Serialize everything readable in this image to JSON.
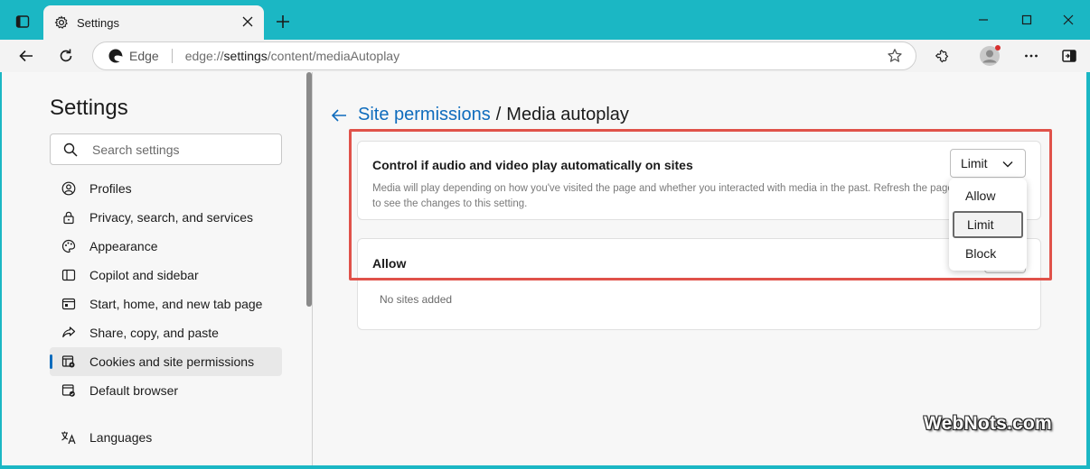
{
  "titlebar": {
    "tab_title": "Settings",
    "new_tab_icon": "plus-icon",
    "window_controls": [
      "minimize",
      "maximize",
      "close"
    ]
  },
  "navbar": {
    "site_label": "Edge",
    "url_prefix": "edge://",
    "url_host": "settings",
    "url_path": "/content/mediaAutoplay"
  },
  "sidebar": {
    "title": "Settings",
    "search_placeholder": "Search settings",
    "items": [
      {
        "label": "Profiles",
        "icon": "profile-icon"
      },
      {
        "label": "Privacy, search, and services",
        "icon": "lock-icon"
      },
      {
        "label": "Appearance",
        "icon": "palette-icon"
      },
      {
        "label": "Copilot and sidebar",
        "icon": "sidebar-icon"
      },
      {
        "label": "Start, home, and new tab page",
        "icon": "home-icon"
      },
      {
        "label": "Share, copy, and paste",
        "icon": "share-icon"
      },
      {
        "label": "Cookies and site permissions",
        "icon": "cookies-icon",
        "active": true
      },
      {
        "label": "Default browser",
        "icon": "browser-icon"
      },
      {
        "label": "Languages",
        "icon": "languages-icon"
      }
    ]
  },
  "main": {
    "breadcrumb_link": "Site permissions",
    "breadcrumb_sep": "/",
    "breadcrumb_current": "Media autoplay",
    "autoplay_card": {
      "heading": "Control if audio and video play automatically on sites",
      "description": "Media will play depending on how you've visited the page and whether you interacted with media in the past. Refresh the page to see the changes to this setting.",
      "selected_value": "Limit"
    },
    "allow_card": {
      "heading": "Allow",
      "empty_text": "No sites added"
    },
    "dropdown_options": [
      "Allow",
      "Limit",
      "Block"
    ],
    "dropdown_selected": "Limit"
  },
  "watermark": "WebNots.com",
  "colors": {
    "titlebar": "#1bb7c4",
    "accent": "#0f6cbd",
    "highlight": "#e0524a"
  }
}
